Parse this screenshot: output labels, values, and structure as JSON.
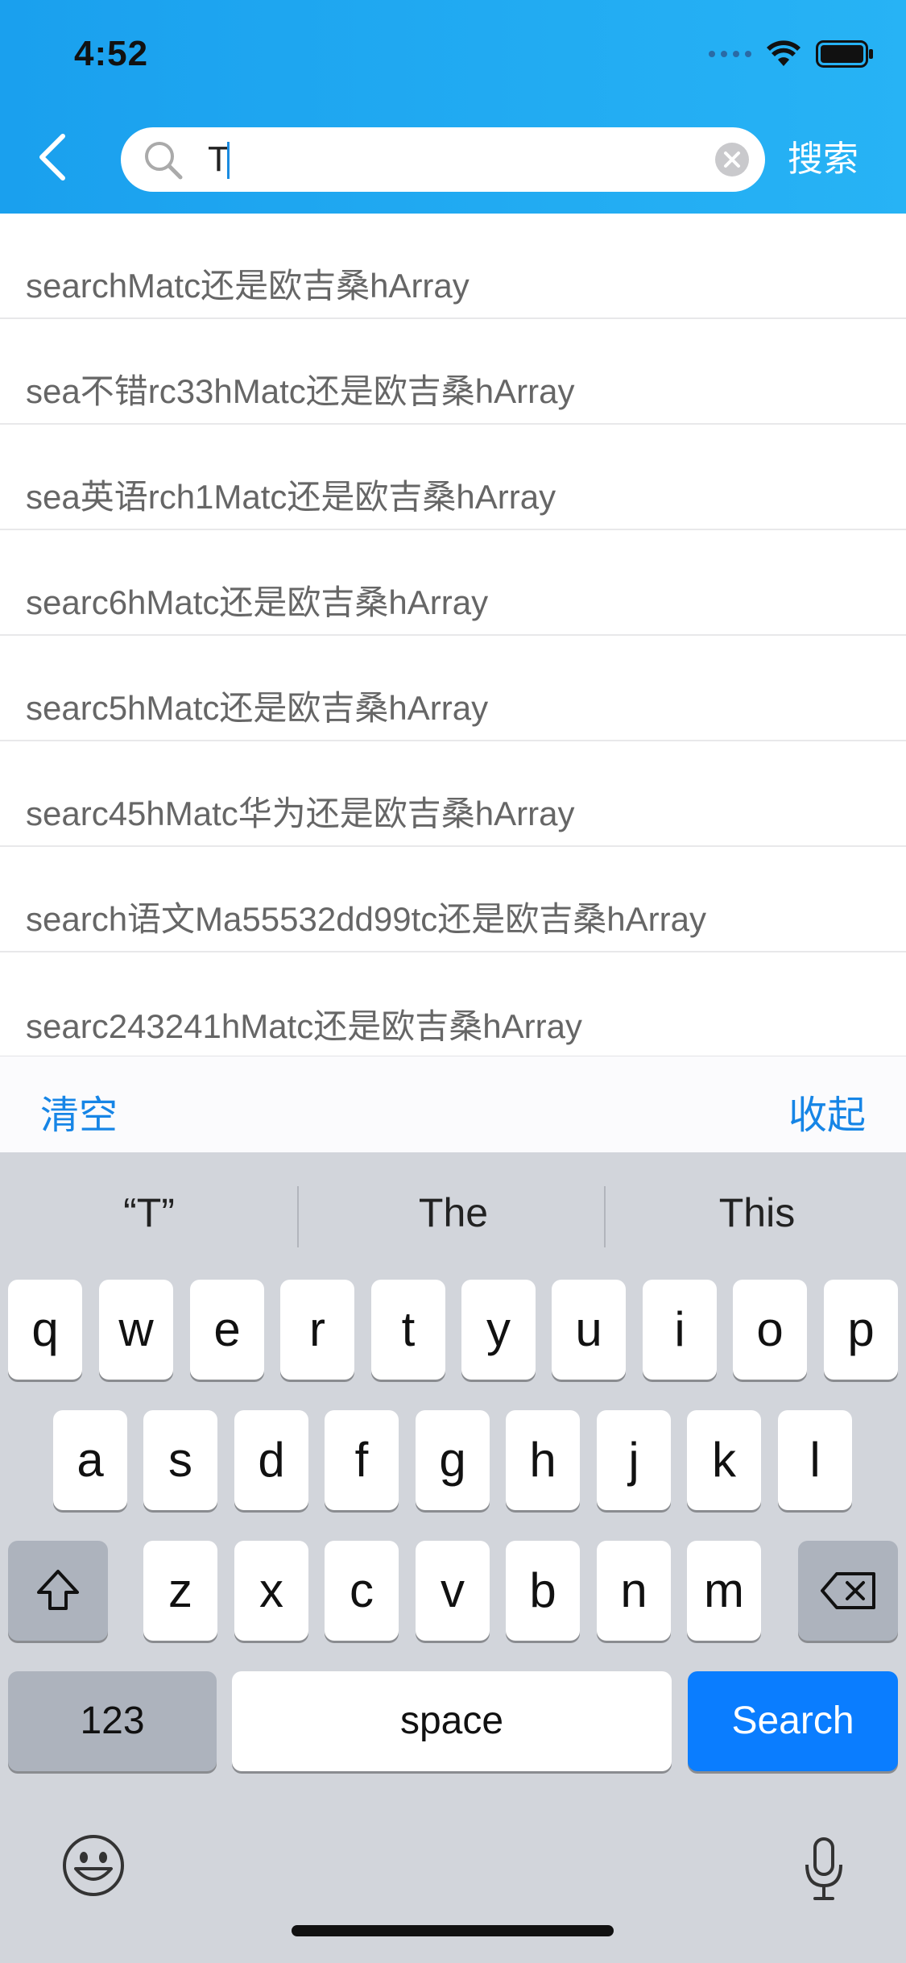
{
  "status": {
    "time": "4:52"
  },
  "header": {
    "search_value": "T",
    "search_button": "搜索"
  },
  "results": [
    "searchMatc还是欧吉桑hArray",
    "sea不错rc33hMatc还是欧吉桑hArray",
    "sea英语rch1Matc还是欧吉桑hArray",
    "searc6hMatc还是欧吉桑hArray",
    "searc5hMatc还是欧吉桑hArray",
    "searc45hMatc华为还是欧吉桑hArray",
    "search语文Ma55532dd99tc还是欧吉桑hArray",
    "searc243241hMatc还是欧吉桑hArray"
  ],
  "bottom_bar": {
    "clear": "清空",
    "collapse": "收起"
  },
  "keyboard": {
    "predictions": [
      "“T”",
      "The",
      "This"
    ],
    "row1": [
      "q",
      "w",
      "e",
      "r",
      "t",
      "y",
      "u",
      "i",
      "o",
      "p"
    ],
    "row2": [
      "a",
      "s",
      "d",
      "f",
      "g",
      "h",
      "j",
      "k",
      "l"
    ],
    "row3": [
      "z",
      "x",
      "c",
      "v",
      "b",
      "n",
      "m"
    ],
    "numbers": "123",
    "space": "space",
    "search": "Search"
  },
  "colors": {
    "header_start": "#1aa0ee",
    "header_end": "#27b3f5",
    "accent": "#1685e6",
    "search_key": "#0a7dff"
  },
  "icons": [
    "back-chevron-icon",
    "magnifier-icon",
    "clear-icon",
    "wifi-icon",
    "battery-icon",
    "shift-icon",
    "backspace-icon",
    "emoji-icon",
    "microphone-icon"
  ]
}
